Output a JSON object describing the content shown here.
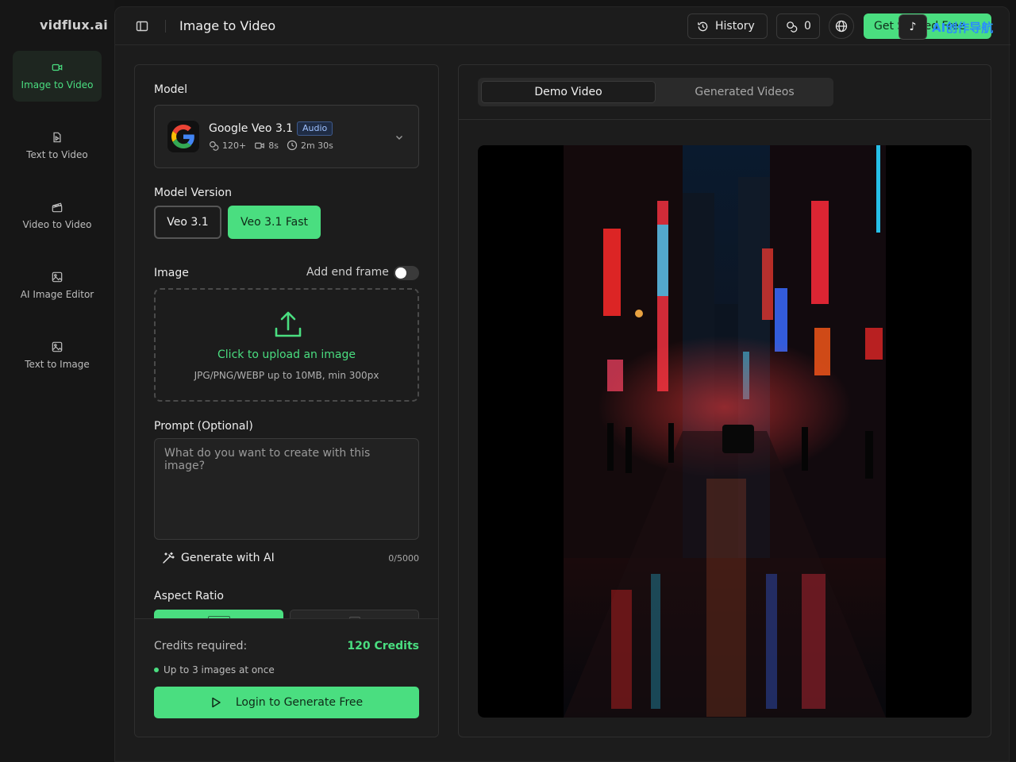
{
  "brand": "vidflux.ai",
  "sidebar": {
    "items": [
      {
        "label": "Image to Video",
        "icon": "video-icon",
        "active": true
      },
      {
        "label": "Text to Video",
        "icon": "file-text-icon",
        "active": false
      },
      {
        "label": "Video to Video",
        "icon": "clapper-icon",
        "active": false
      },
      {
        "label": "AI Image Editor",
        "icon": "image-icon",
        "active": false
      },
      {
        "label": "Text to Image",
        "icon": "image-icon",
        "active": false
      }
    ]
  },
  "header": {
    "title": "Image to Video",
    "history_label": "History",
    "credits_count": "0",
    "cta_label": "Get Started Free"
  },
  "watermark": {
    "text": "AI创作导航"
  },
  "form": {
    "model_label": "Model",
    "model": {
      "name": "Google Veo 3.1",
      "badge": "Audio",
      "credits": "120+",
      "duration": "8s",
      "time": "2m 30s"
    },
    "version_label": "Model Version",
    "versions": [
      {
        "label": "Veo 3.1",
        "selected": false
      },
      {
        "label": "Veo 3.1 Fast",
        "selected": true
      }
    ],
    "image_label": "Image",
    "end_frame_label": "Add end frame",
    "end_frame_on": false,
    "upload_title": "Click to upload an image",
    "upload_hint": "JPG/PNG/WEBP up to 10MB, min 300px",
    "prompt_label": "Prompt (Optional)",
    "prompt_placeholder": "What do you want to create with this image?",
    "generate_ai_label": "Generate with AI",
    "char_counter": "0/5000",
    "aspect_label": "Aspect Ratio"
  },
  "footer": {
    "credits_label": "Credits required:",
    "credits_value": "120 Credits",
    "bullet": "Up to 3 images at once",
    "login_label": "Login to Generate Free"
  },
  "preview": {
    "tabs": [
      {
        "label": "Demo Video",
        "active": true
      },
      {
        "label": "Generated Videos",
        "active": false
      }
    ]
  },
  "colors": {
    "accent": "#4ade80",
    "badge_blue": "#9ec1ff"
  }
}
